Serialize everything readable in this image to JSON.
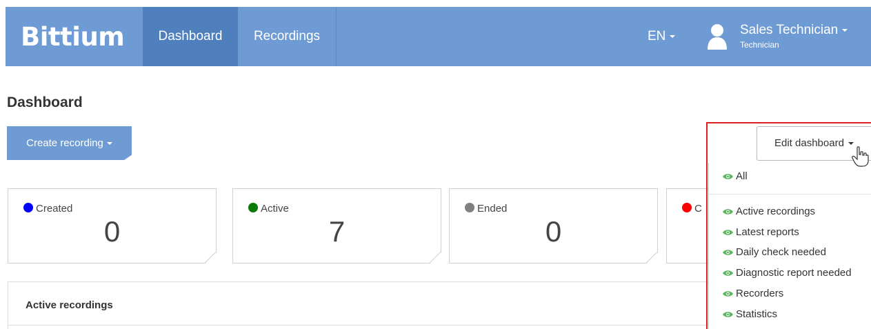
{
  "navbar": {
    "brand": "Bittium",
    "nav_items": [
      "Dashboard",
      "Recordings"
    ],
    "language": "EN",
    "user": {
      "name": "Sales Technician",
      "role": "Technician"
    }
  },
  "page": {
    "title": "Dashboard"
  },
  "actions": {
    "create_recording_label": "Create recording",
    "edit_dashboard_label": "Edit dashboard"
  },
  "status_cards": [
    {
      "label": "Created",
      "value": "0",
      "color": "#0000ff"
    },
    {
      "label": "Active",
      "value": "7",
      "color": "#0a7a0a"
    },
    {
      "label": "Ended",
      "value": "0",
      "color": "#808080"
    },
    {
      "label": "C",
      "value": "",
      "color": "#ff0000"
    }
  ],
  "panel": {
    "title": "Active recordings"
  },
  "edit_menu": {
    "items": [
      "All",
      "Active recordings",
      "Latest reports",
      "Daily check needed",
      "Diagnostic report needed",
      "Recorders",
      "Statistics"
    ],
    "icon": "eye-icon",
    "icon_color": "#4caf50"
  },
  "colors": {
    "navbar": "#6f9bd4",
    "nav_active": "#4f7fbd",
    "highlight": "#e02020"
  }
}
